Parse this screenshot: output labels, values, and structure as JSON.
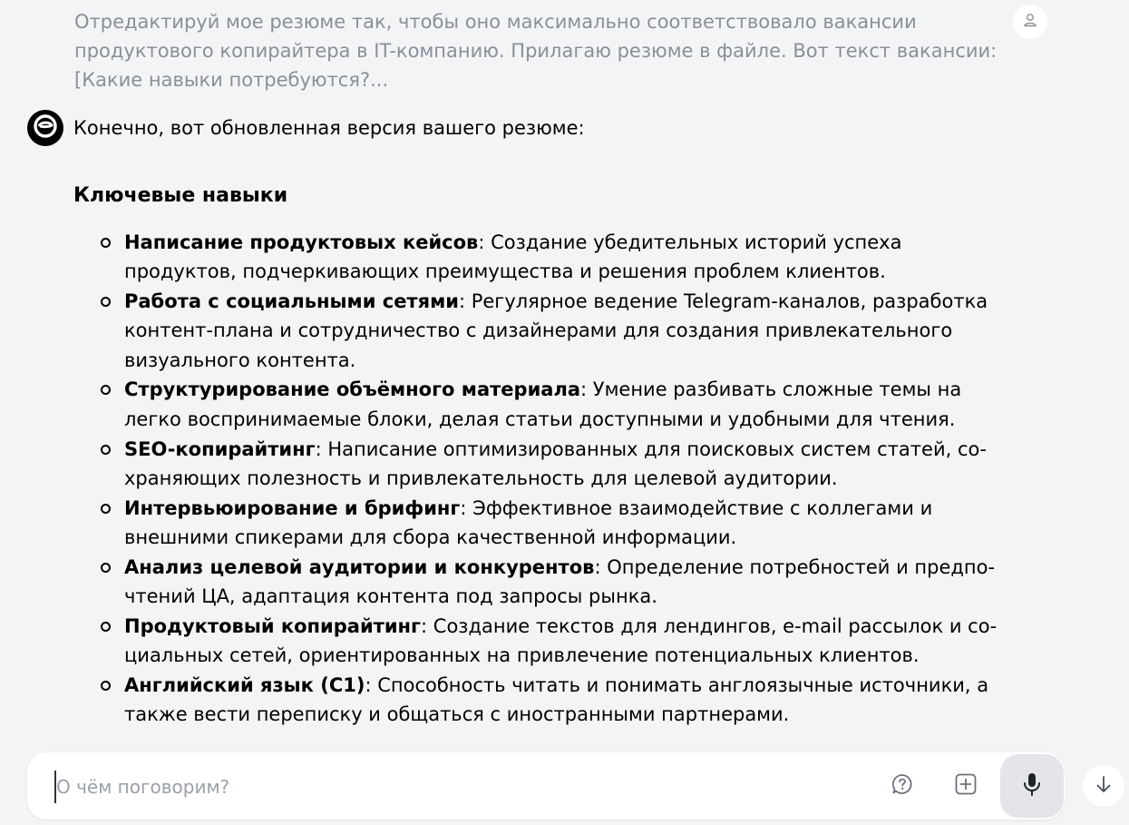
{
  "user_message": {
    "text": "Отредактируй мое резюме так, чтобы оно максимально соответствовало вакансии продук­тового копирайтера в IT-компанию. Прилагаю резюме в файле. Вот текст вакансии: [Какие навыки потребуются?..."
  },
  "assistant": {
    "intro": "Конечно, вот обновленная версия вашего резюме:",
    "section_title": "Ключевые навыки",
    "skills": [
      {
        "title": "Написание продуктовых кейсов",
        "text": ": Создание убедительных историй успеха продуктов, подчеркивающих преимущества и решения проблем клиентов."
      },
      {
        "title": "Работа с социальными сетями",
        "text": ": Регулярное ведение Telegram-каналов, разработка контент-плана и сотрудничество с дизайнерами для создания привлекательного визу­ального контента."
      },
      {
        "title": "Структурирование объёмного материала",
        "text": ": Умение разбивать сложные темы на легко воспринимаемые блоки, делая статьи доступными и удобными для чтения."
      },
      {
        "title": "SEO-копирайтинг",
        "text": ": Написание оптимизированных для поисковых систем статей, со­храняющих полезность и привлекательность для целевой аудитории."
      },
      {
        "title": "Интервьюирование и брифинг",
        "text": ": Эффективное взаимодействие с коллегами и внешними спикерами для сбора качественной информации."
      },
      {
        "title": "Анализ целевой аудитории и конкурентов",
        "text": ": Определение потребностей и предпо­чтений ЦА, адаптация контента под запросы рынка."
      },
      {
        "title": "Продуктовый копирайтинг",
        "text": ": Создание текстов для лендингов, e-mail рассылок и со­циальных сетей, ориентированных на привлечение потенциальных клиентов."
      },
      {
        "title": "Английский язык (C1)",
        "text": ": Способность читать и понимать англоязычные источники, а также вести переписку и общаться с иностранными партнерами."
      }
    ]
  },
  "composer": {
    "placeholder": "О чём поговорим?"
  },
  "icons": {
    "user_avatar": "user-icon",
    "bot_avatar": "assistant-logo-icon",
    "help": "help-question-icon",
    "attach": "add-square-icon",
    "mic": "microphone-icon",
    "scroll": "arrow-down-icon"
  },
  "colors": {
    "background": "#f3f4f6",
    "user_text": "#8a8f98",
    "mic_button": "#e3e5ea"
  }
}
